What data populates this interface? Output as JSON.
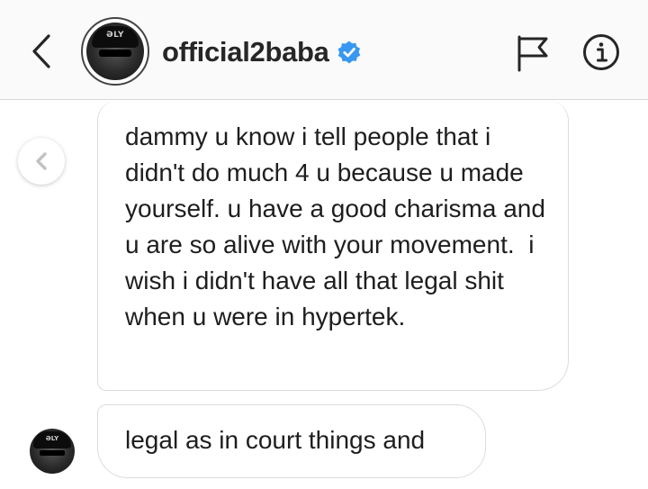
{
  "header": {
    "username": "official2baba",
    "verified": true,
    "avatar_cap_text": "ƏLY",
    "icons": {
      "back": "chevron-left-icon",
      "verified": "verified-badge-icon",
      "report": "flag-icon",
      "info": "info-icon"
    },
    "verified_color": "#3897f0"
  },
  "thread": {
    "older_icon": "chevron-left-icon",
    "messages": [
      {
        "sender": "official2baba",
        "text": "dammy u know i tell people that i didn't do much 4 u because u made yourself. u have a good charisma and u are so alive with your movement.  i wish i didn't have all that legal shit when u were in hypertek."
      },
      {
        "sender": "official2baba",
        "text": "legal as in court things and",
        "avatar_cap_text": "ƏLY"
      }
    ]
  }
}
